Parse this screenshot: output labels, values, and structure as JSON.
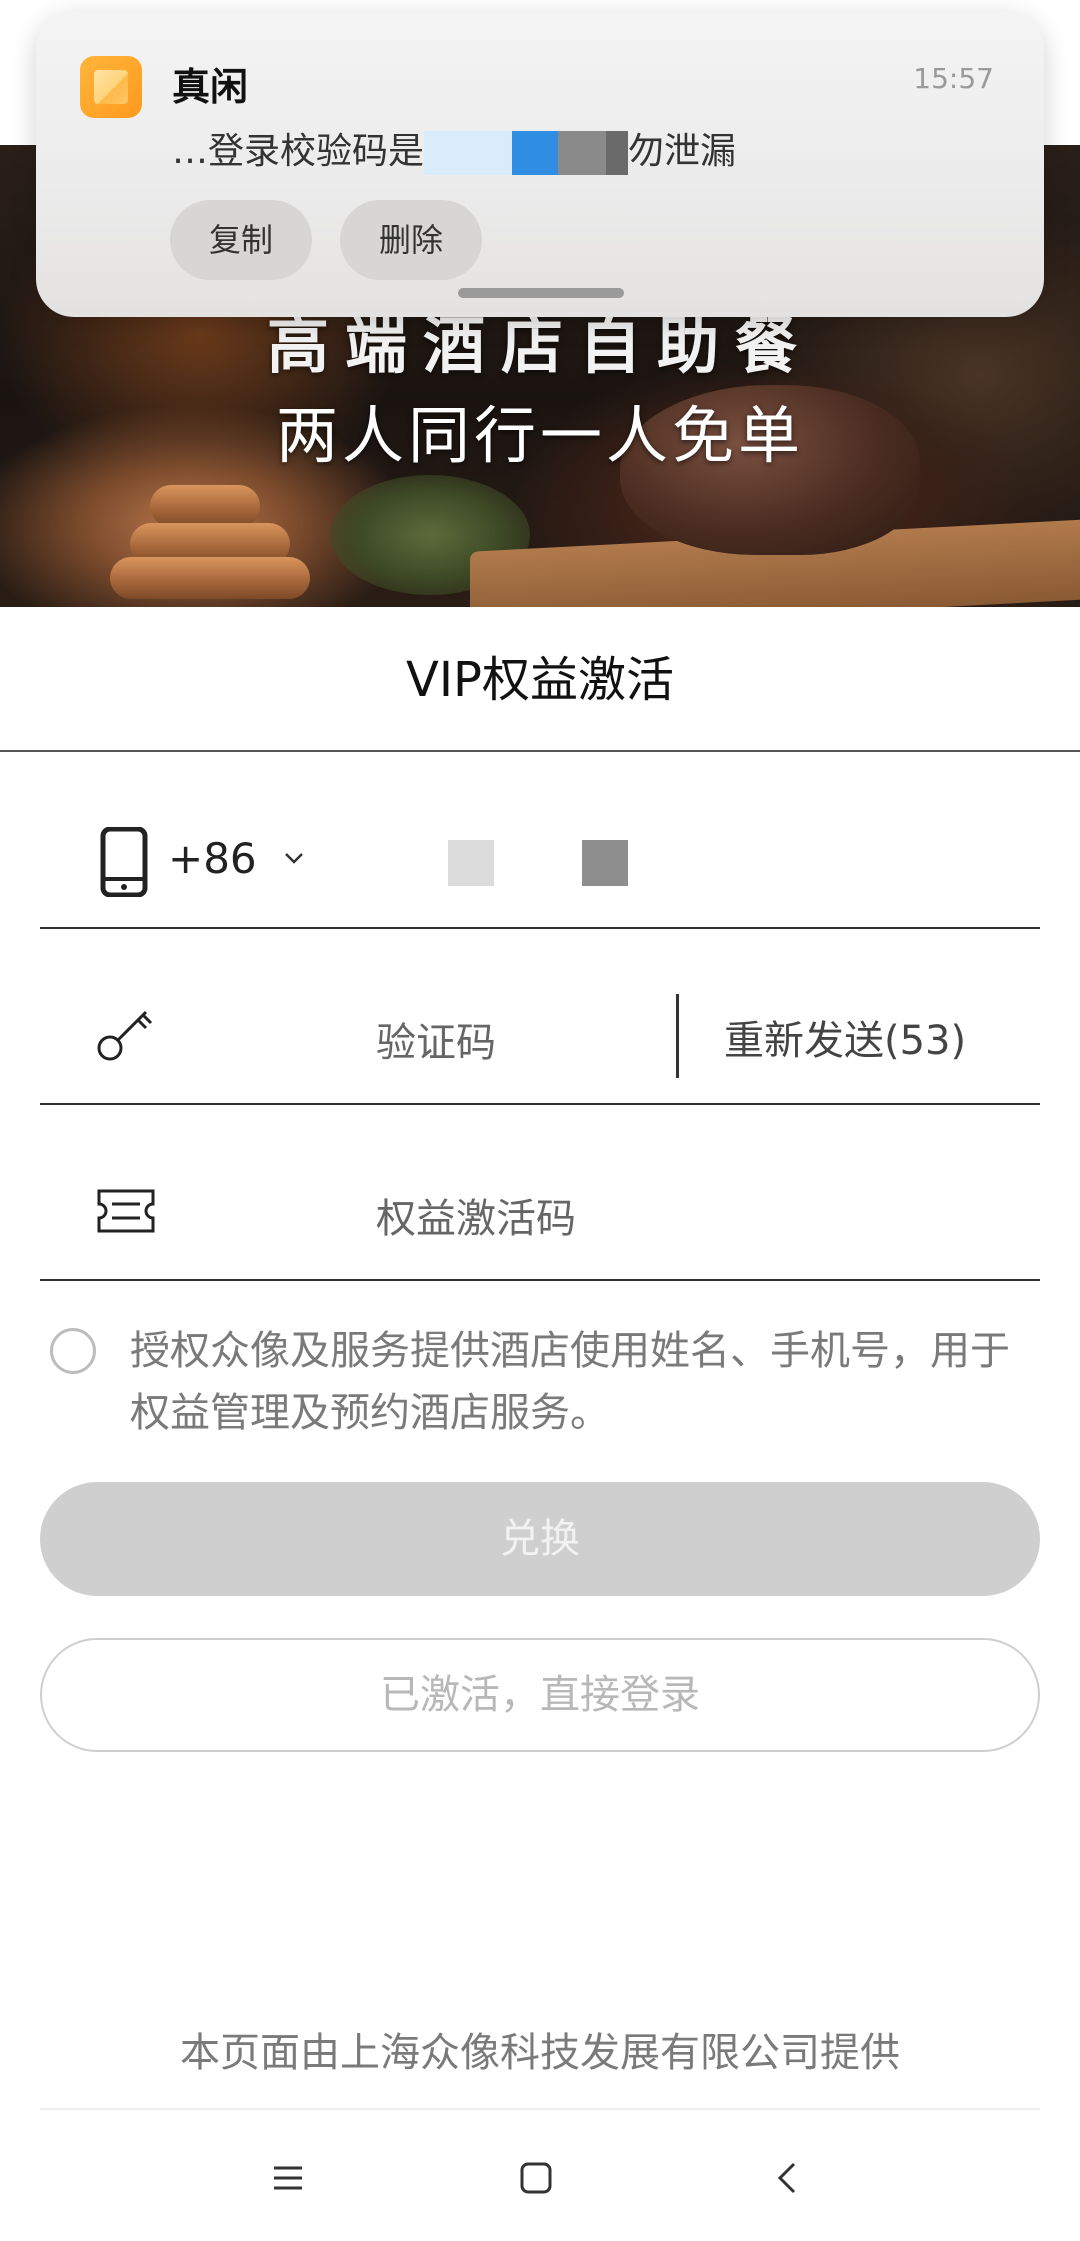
{
  "notification": {
    "app_name": "真闲",
    "time": "15:57",
    "body_prefix": "…登录校验码是",
    "body_suffix": "勿泄漏",
    "actions": [
      "复制",
      "删除"
    ]
  },
  "banner": {
    "line1": "高端酒店自助餐",
    "line2": "两人同行一人免单"
  },
  "form": {
    "title": "VIP权益激活",
    "country_code": "+86",
    "code_placeholder": "验证码",
    "resend_label": "重新发送(53)",
    "activation_placeholder": "权益激活码",
    "agreement": "授权众像及服务提供酒店使用姓名、手机号，用于权益管理及预约酒店服务。",
    "redeem_button": "兑换",
    "login_button": "已激活，直接登录"
  },
  "footer": {
    "provider": "本页面由上海众像科技发展有限公司提供"
  },
  "icons": {
    "phone": "smartphone-icon",
    "key": "key-icon",
    "ticket": "ticket-icon",
    "chevron": "chevron-down-icon",
    "nav_menu": "menu-icon",
    "nav_home": "home-square-icon",
    "nav_back": "back-arrow-icon"
  },
  "colors": {
    "app_icon": "#ff9a1f",
    "primary_disabled": "#cfcfcf"
  }
}
